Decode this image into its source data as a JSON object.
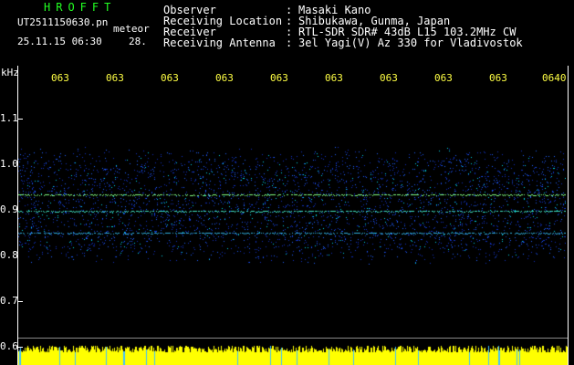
{
  "header": {
    "logo_text": "HROFFT",
    "filename": "UT2511150630.pn",
    "meteor_label": "meteor",
    "datetime": "25.11.15 06:30",
    "count": "28."
  },
  "info": [
    {
      "label": "Observer",
      "value": "Masaki Kano"
    },
    {
      "label": "Receiving Location",
      "value": "Shibukawa, Gunma, Japan"
    },
    {
      "label": "Receiver",
      "value": "RTL-SDR SDR# 43dB L15 103.2MHz CW"
    },
    {
      "label": "Receiving Antenna",
      "value": "3el Yagi(V) Az 330 for Vladivostok"
    }
  ],
  "axis": {
    "unit": "kHz",
    "y_ticks": [
      "1.1",
      "1.0",
      "0.9",
      "0.8",
      "0.7",
      "0.6"
    ],
    "x_ticks": [
      "063",
      "063",
      "063",
      "063",
      "063",
      "063",
      "063",
      "063",
      "063",
      "0640"
    ]
  },
  "colors": {
    "text_green": "#22ff22",
    "text_white": "#ffffff",
    "text_yellow": "#ffff44",
    "noise_blue": "#1a3cff",
    "signal_cyan": "#00e0e0",
    "signal_line": "#80ff80",
    "bottom_bar": "#ffff00"
  }
}
